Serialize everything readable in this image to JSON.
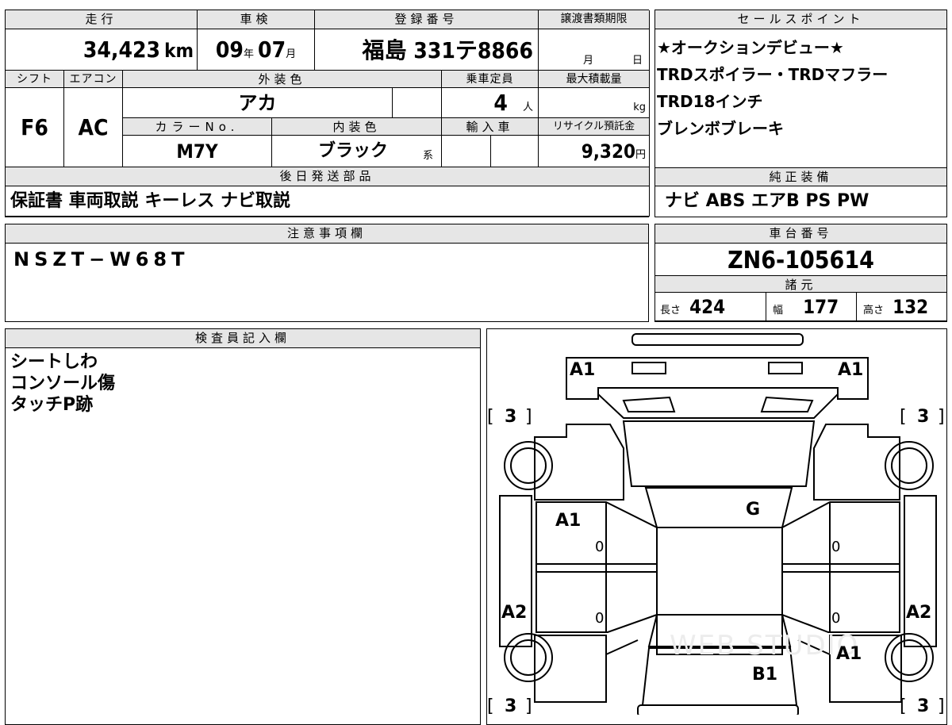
{
  "top_table": {
    "mileage_label": "走行",
    "mileage": "34,423",
    "mileage_unit": "km",
    "shaken_label": "車検",
    "shaken_year": "09",
    "shaken_year_unit": "年",
    "shaken_month": "07",
    "shaken_month_unit": "月",
    "reg_label": "登録番号",
    "reg_number": "福島 331テ8866",
    "transfer_label": "譲渡書類期限",
    "transfer_month_unit": "月",
    "transfer_day_unit": "日",
    "shift_label": "シフト",
    "shift": "F6",
    "ac_label": "エアコン",
    "ac": "AC",
    "ext_color_label": "外装色",
    "ext_color": "アカ",
    "capacity_label": "乗車定員",
    "capacity": "4",
    "capacity_unit": "人",
    "max_load_label": "最大積載量",
    "max_load_unit": "kg",
    "color_no_label": "カラーNo.",
    "color_no": "M7Y",
    "int_color_label": "内装色",
    "int_color": "ブラック",
    "int_color_suffix": "系",
    "import_label": "輸入車",
    "recycle_label": "リサイクル預託金",
    "recycle": "9,320",
    "recycle_unit": "円",
    "later_parts_label": "後日発送部品",
    "later_parts": "保証書 車両取説 キーレス ナビ取説"
  },
  "sales_point": {
    "label": "セールスポイント",
    "lines": [
      "★オークションデビュー★",
      "TRDスポイラー・TRDマフラー",
      "TRD18インチ",
      "ブレンボブレーキ"
    ]
  },
  "genuine_equipment": {
    "label": "純正装備",
    "value": "ナビ ABS エアB PS PW"
  },
  "notes": {
    "label": "注意事項欄",
    "value": "NSZT−W68T"
  },
  "chassis": {
    "label": "車台番号",
    "value": "ZN6-105614",
    "spec_label": "諸元",
    "length_label": "長さ",
    "length": "424",
    "width_label": "幅",
    "width": "177",
    "height_label": "高さ",
    "height": "132"
  },
  "inspector": {
    "label": "検査員記入欄",
    "lines": [
      "シートしわ",
      "コンソール傷",
      "タッチP跡"
    ]
  },
  "diagram": {
    "marks": {
      "front_left": "A1",
      "front_right": "A1",
      "tire_fl": "3",
      "tire_fr": "3",
      "tire_rl": "3",
      "tire_rr": "3",
      "door_left": "A1",
      "windshield": "G",
      "door_fl_zero": "0",
      "door_fr_zero": "0",
      "door_rl_zero": "0",
      "door_rr_zero": "0",
      "rear_quarter_left": "A2",
      "rear_quarter_right": "A2",
      "rear_right": "A1",
      "trunk": "B1"
    },
    "watermark": "WEB STUDIO"
  }
}
